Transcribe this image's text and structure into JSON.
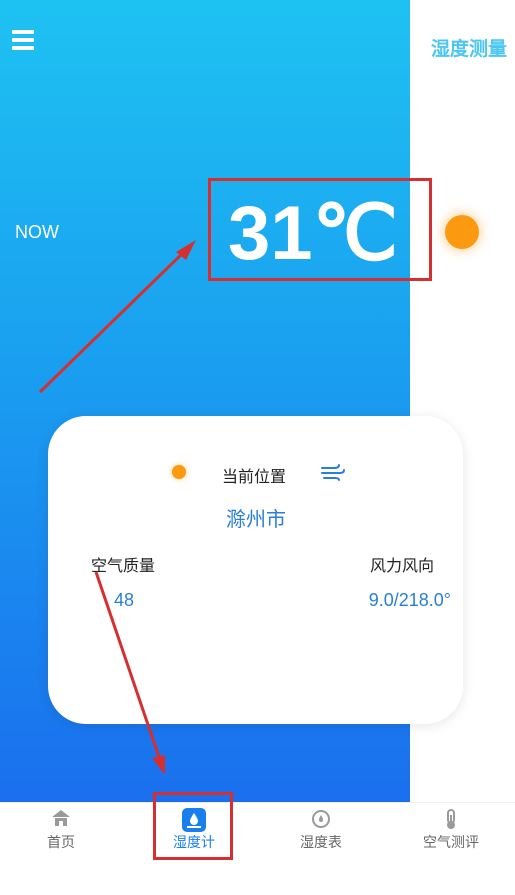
{
  "header": {
    "title": "湿度测量"
  },
  "hero": {
    "now_label": "NOW",
    "temperature": "31℃"
  },
  "card": {
    "location_label": "当前位置",
    "city": "滁州市",
    "air_quality_label": "空气质量",
    "air_quality_value": "48",
    "wind_label": "风力风向",
    "wind_value": "9.0/218.0°"
  },
  "nav": {
    "items": [
      {
        "label": "首页",
        "icon": "home-icon"
      },
      {
        "label": "湿度计",
        "icon": "humidity-meter-icon"
      },
      {
        "label": "湿度表",
        "icon": "gauge-icon"
      },
      {
        "label": "空气测评",
        "icon": "thermometer-icon"
      }
    ],
    "active": 1
  },
  "colors": {
    "gradient_top": "#1ec2f2",
    "gradient_bottom": "#1a6fee",
    "accent": "#2a7ed8",
    "sun": "#fb9a10",
    "highlight": "#d62f2f"
  }
}
